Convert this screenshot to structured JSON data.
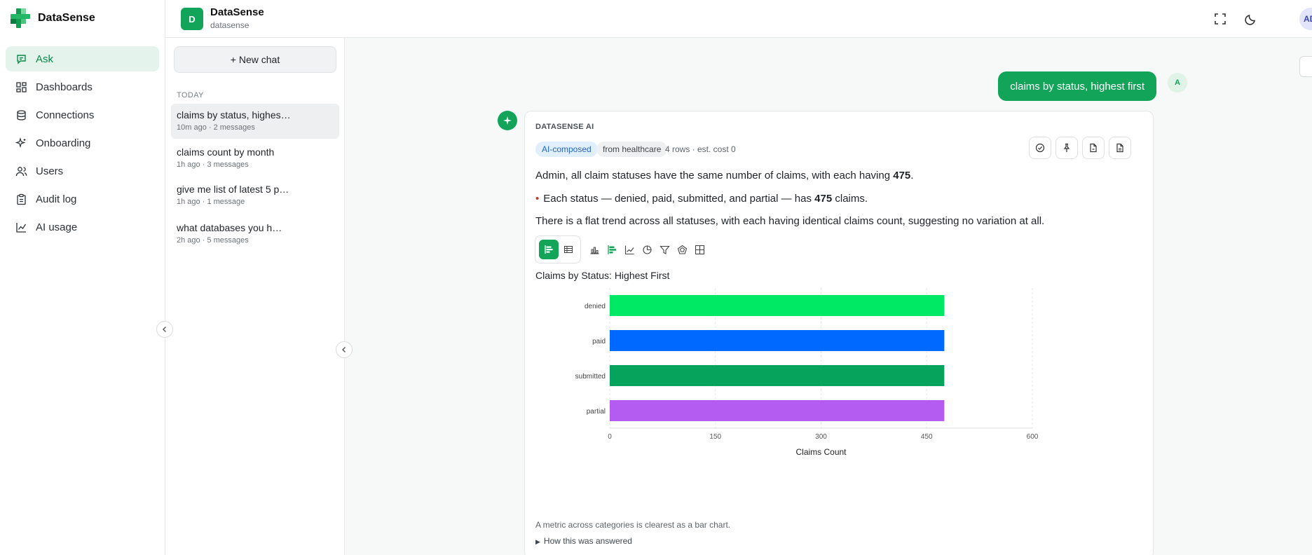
{
  "app": {
    "name": "DataSense"
  },
  "nav": {
    "items": [
      {
        "label": "Ask",
        "icon": "chat-icon",
        "active": true
      },
      {
        "label": "Dashboards",
        "icon": "dashboard-icon",
        "active": false
      },
      {
        "label": "Connections",
        "icon": "database-icon",
        "active": false
      },
      {
        "label": "Onboarding",
        "icon": "sparkle-icon",
        "active": false
      },
      {
        "label": "Users",
        "icon": "users-icon",
        "active": false
      },
      {
        "label": "Audit log",
        "icon": "clipboard-icon",
        "active": false
      },
      {
        "label": "AI usage",
        "icon": "line-chart-icon",
        "active": false
      }
    ]
  },
  "workspace": {
    "badge": "D",
    "name": "DataSense",
    "slug": "datasense",
    "user_initials": "AD"
  },
  "chats": {
    "new_chat_label": "+ New chat",
    "group_label": "TODAY",
    "items": [
      {
        "title": "claims by status, highes…",
        "meta": "10m ago · 2 messages"
      },
      {
        "title": "claims count by month",
        "meta": "1h ago · 3 messages"
      },
      {
        "title": "give me list of latest 5 p…",
        "meta": "1h ago · 1 message"
      },
      {
        "title": "what databases you h…",
        "meta": "2h ago · 5 messages"
      }
    ]
  },
  "conversation": {
    "user_avatar": "A",
    "user_message": "claims by status, highest first",
    "assistant": {
      "label": "DATASENSE AI",
      "pill_ai": "AI-composed",
      "pill_source": "from healthcare",
      "meta": "4 rows · est. cost 0",
      "summary_pre": "Admin, all claim statuses have the same number of claims, with each having ",
      "summary_num": "475",
      "summary_post": ".",
      "bullet_pre": "Each status — denied, paid, submitted, and partial — has ",
      "bullet_num": "475",
      "bullet_post": " claims.",
      "trend": "There is a flat trend across all statuses, with each having identical claims count, suggesting no variation at all.",
      "footnote": "A metric across categories is clearest as a bar chart.",
      "how_label": "How this was answered"
    }
  },
  "chart_data": {
    "type": "bar",
    "orientation": "horizontal",
    "title": "Claims by Status: Highest First",
    "categories": [
      "denied",
      "paid",
      "submitted",
      "partial"
    ],
    "values": [
      475,
      475,
      475,
      475
    ],
    "colors": [
      "#00e965",
      "#0069ff",
      "#05a35b",
      "#b45bf2"
    ],
    "xlabel": "Claims Count",
    "ylabel": "",
    "xlim": [
      0,
      600
    ],
    "xticks": [
      0,
      150,
      300,
      450,
      600
    ],
    "grid": true
  }
}
